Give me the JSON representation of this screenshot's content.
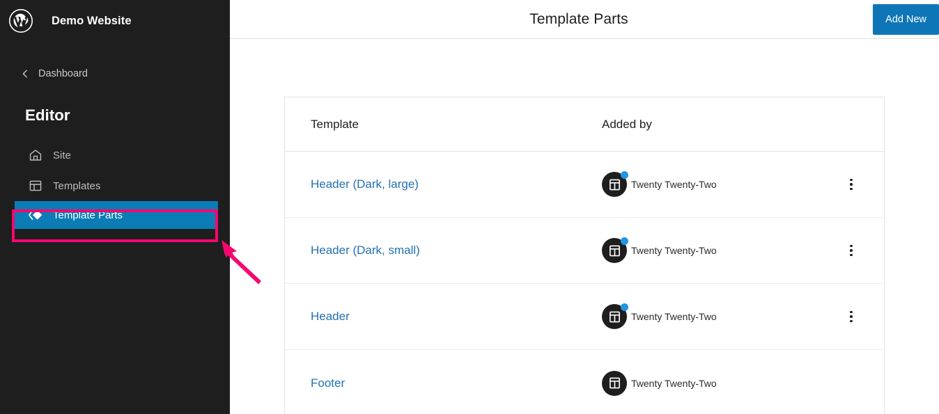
{
  "sidebar": {
    "logo_icon": "wordpress-logo-icon",
    "brand_title": "Demo Website",
    "back_link": {
      "label": "Dashboard",
      "icon": "chevron-left-icon"
    },
    "section_heading": "Editor",
    "items": [
      {
        "label": "Site",
        "icon": "home-icon",
        "selected": false
      },
      {
        "label": "Templates",
        "icon": "layout-icon",
        "selected": false
      },
      {
        "label": "Template Parts",
        "icon": "template-part-icon",
        "selected": true
      }
    ]
  },
  "header": {
    "title": "Template Parts",
    "add_new_label": "Add New"
  },
  "table": {
    "columns": [
      "Template",
      "Added by"
    ],
    "rows": [
      {
        "template": "Header (Dark, large)",
        "author": "Twenty Twenty-Two",
        "avatar_icon": "template-part-avatar-icon",
        "has_badge": true,
        "has_menu": true
      },
      {
        "template": "Header (Dark, small)",
        "author": "Twenty Twenty-Two",
        "avatar_icon": "template-part-avatar-icon",
        "has_badge": true,
        "has_menu": true
      },
      {
        "template": "Header",
        "author": "Twenty Twenty-Two",
        "avatar_icon": "template-part-avatar-icon",
        "has_badge": true,
        "has_menu": true
      },
      {
        "template": "Footer",
        "author": "Twenty Twenty-Two",
        "avatar_icon": "template-part-avatar-icon",
        "has_badge": false,
        "has_menu": false
      }
    ]
  },
  "annotation": {
    "highlight_color": "#f5076f",
    "target": "Template Parts",
    "arrow_icon": "annotation-arrow-icon"
  },
  "colors": {
    "sidebar_bg": "#1e1e1e",
    "accent_blue": "#0e76b7",
    "selected_blue": "#0b7cb5",
    "link_blue": "#2271b1",
    "annotation_pink": "#f5076f",
    "badge_blue": "#2196e3"
  }
}
